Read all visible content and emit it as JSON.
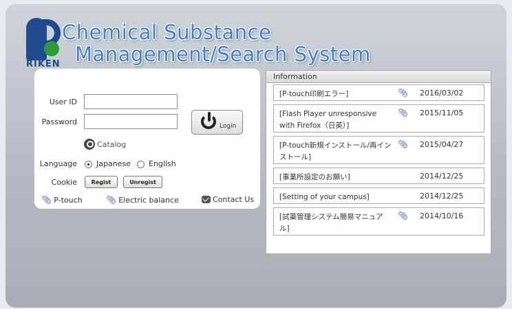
{
  "header": {
    "logo_text": "RIKEN",
    "title_line1": "Chemical Substance",
    "title_line2": "Management/Search System"
  },
  "login": {
    "user_id_label": "User ID",
    "password_label": "Password",
    "user_id_value": "",
    "password_value": "",
    "login_label": "Login",
    "catalog_label": "Catalog",
    "language_label": "Language",
    "language_options": [
      "Japanese",
      "English"
    ],
    "language_selected": "Japanese",
    "cookie_label": "Cookie",
    "regist_label": "Regist",
    "unregist_label": "Unregist",
    "links": {
      "ptouch": "P-touch",
      "electric": "Electric balance",
      "contact": "Contact Us"
    }
  },
  "information": {
    "header": "Information",
    "items": [
      {
        "title": "[P-touch印刷エラー]",
        "has_attachment": true,
        "date": "2016/03/02"
      },
      {
        "title": "[Flash Player unresponsive with Firefox（日英）]",
        "has_attachment": true,
        "date": "2015/11/05"
      },
      {
        "title": "[P-touch新規インストール/再インストール]",
        "has_attachment": true,
        "date": "2015/04/27"
      },
      {
        "title": "[事業所設定のお願い]",
        "has_attachment": false,
        "date": "2014/12/25"
      },
      {
        "title": "[Setting of your campus]",
        "has_attachment": false,
        "date": "2014/12/25"
      },
      {
        "title": "[試薬管理システム簡易マニュアル]",
        "has_attachment": true,
        "date": "2014/10/16"
      }
    ]
  },
  "colors": {
    "title_blue": "#3f7fc6",
    "logo_blue": "#1f4a8c",
    "logo_green": "#2e9b3a",
    "link_blue": "#3a63b8"
  },
  "icons": [
    "power-icon",
    "magnifier-icon",
    "paperclip-icon",
    "envelope-icon"
  ]
}
